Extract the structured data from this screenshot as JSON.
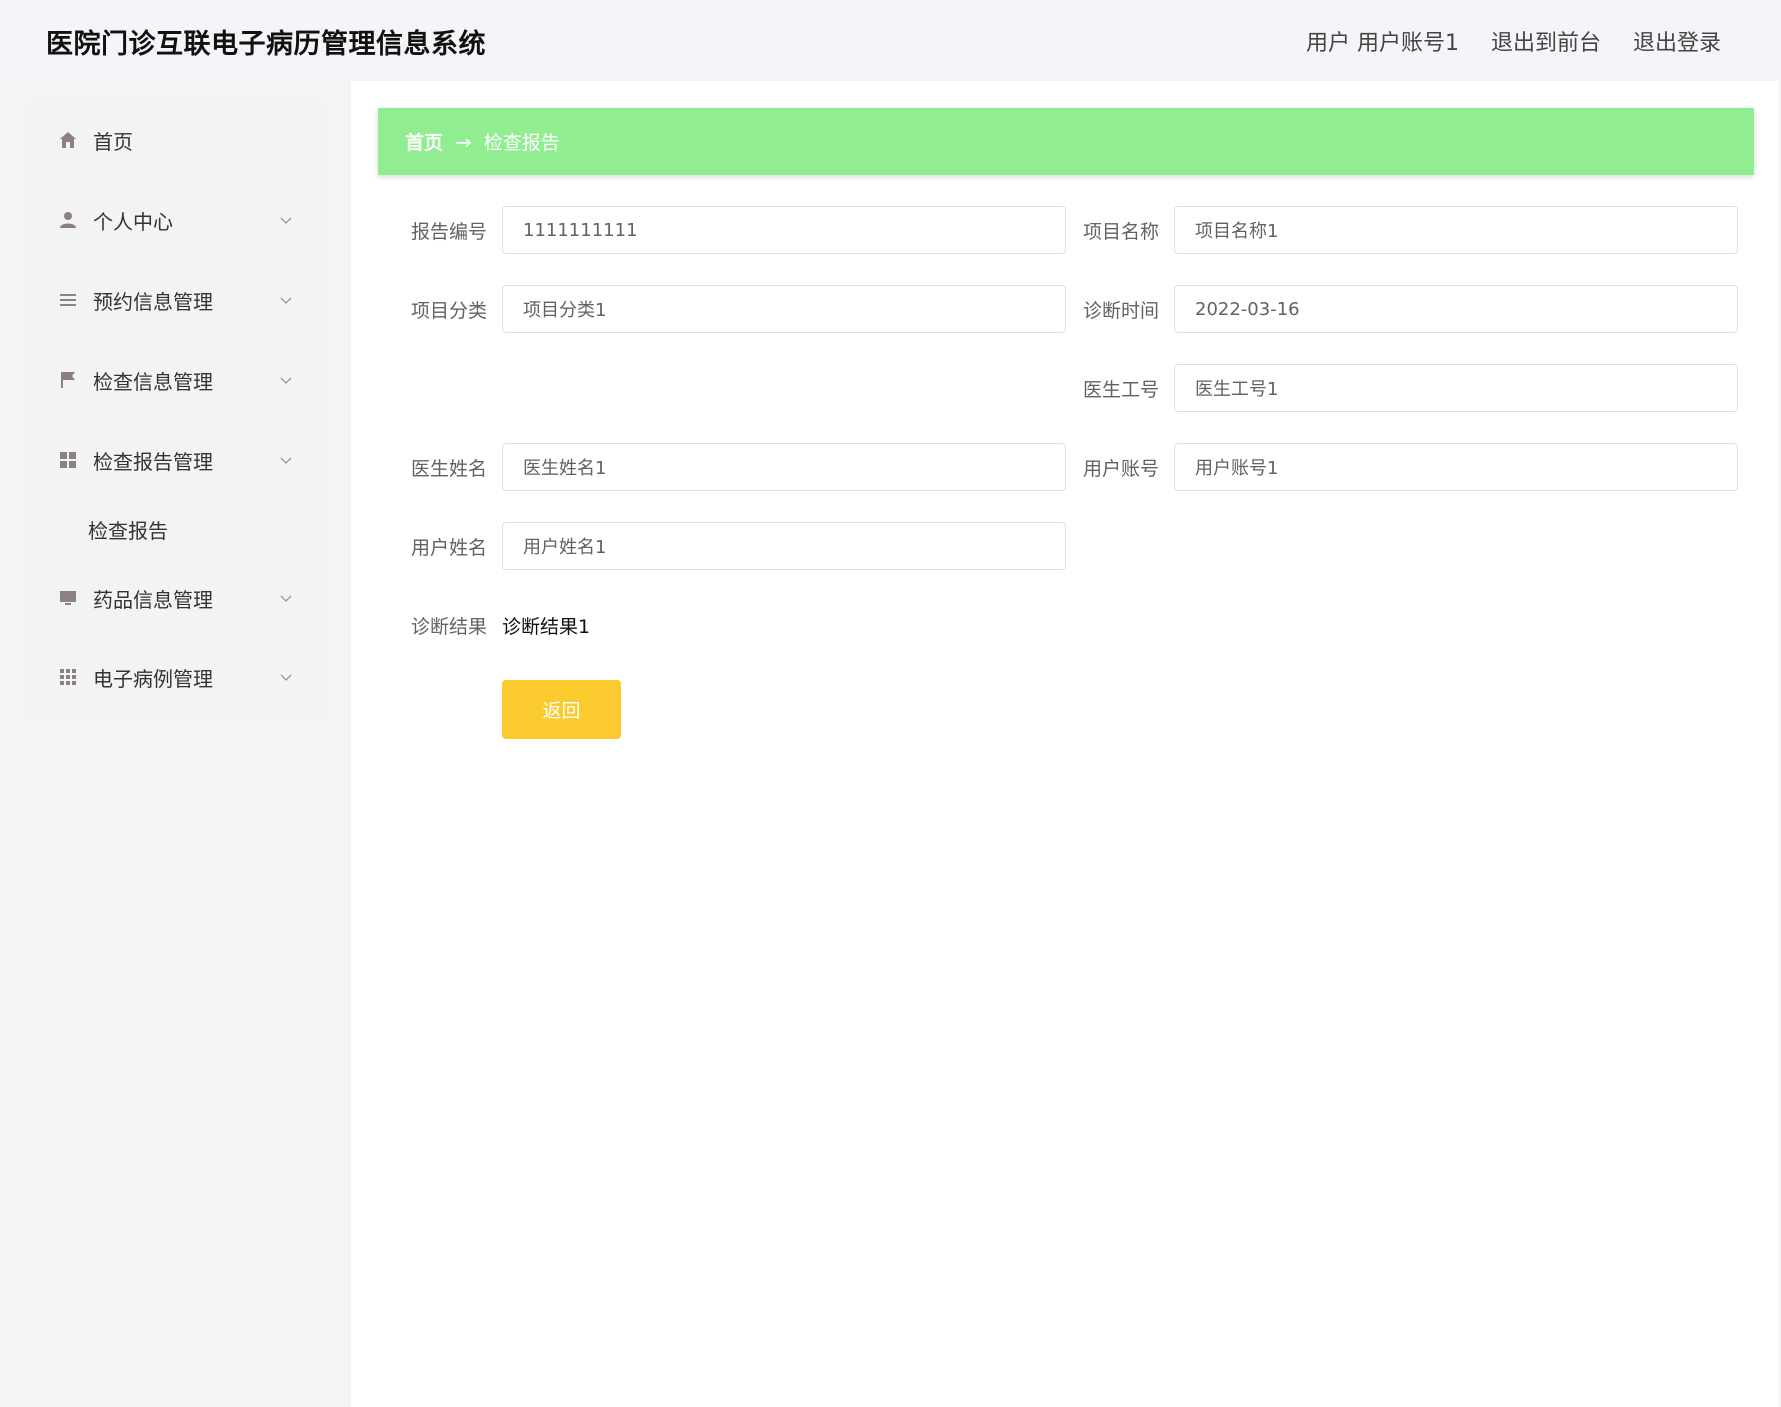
{
  "header": {
    "title": "医院门诊互联电子病历管理信息系统",
    "user_label": "用户 用户账号1",
    "to_front_label": "退出到前台",
    "logout_label": "退出登录"
  },
  "sidebar": {
    "items": [
      {
        "label": "首页",
        "icon": "home-icon"
      },
      {
        "label": "个人中心",
        "icon": "user-icon"
      },
      {
        "label": "预约信息管理",
        "icon": "list-icon"
      },
      {
        "label": "检查信息管理",
        "icon": "flag-icon"
      },
      {
        "label": "检查报告管理",
        "icon": "grid-icon"
      },
      {
        "label": "药品信息管理",
        "icon": "monitor-icon"
      },
      {
        "label": "电子病例管理",
        "icon": "apps-icon"
      }
    ],
    "subitem": "检查报告"
  },
  "breadcrumb": {
    "home": "首页",
    "separator": "→",
    "current": "检查报告"
  },
  "form": {
    "report_no_label": "报告编号",
    "report_no": "1111111111",
    "project_name_label": "项目名称",
    "project_name": "项目名称1",
    "project_category_label": "项目分类",
    "project_category": "项目分类1",
    "diagnosis_time_label": "诊断时间",
    "diagnosis_time": "2022-03-16",
    "doctor_id_label": "医生工号",
    "doctor_id": "医生工号1",
    "doctor_name_label": "医生姓名",
    "doctor_name": "医生姓名1",
    "user_account_label": "用户账号",
    "user_account": "用户账号1",
    "user_name_label": "用户姓名",
    "user_name": "用户姓名1",
    "diagnosis_result_label": "诊断结果",
    "diagnosis_result": "诊断结果1",
    "back_label": "返回"
  },
  "colors": {
    "breadcrumb_bg": "#90ee90",
    "back_button_bg": "#fbca2f",
    "icon_color": "#8c7f86"
  }
}
